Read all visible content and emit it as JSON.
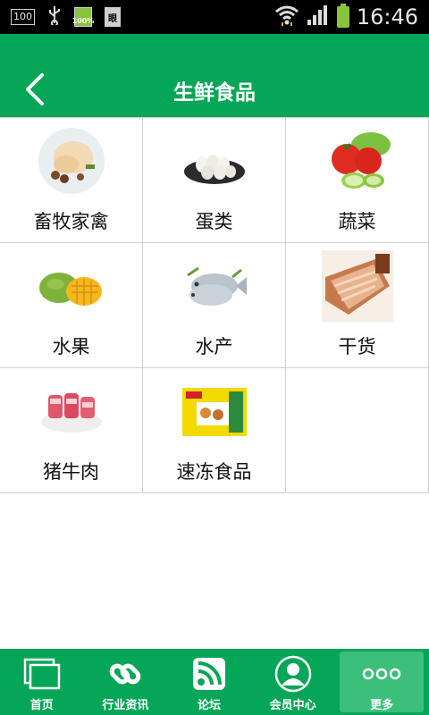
{
  "status_bar": {
    "sim_label": "100",
    "battery_small_label": "100%",
    "doc_label": "眼",
    "time": "16:46"
  },
  "header": {
    "title": "生鲜食品",
    "back_icon": "chevron-left-icon"
  },
  "categories": [
    {
      "label": "畜牧家禽",
      "icon": "poultry-image"
    },
    {
      "label": "蛋类",
      "icon": "eggs-image"
    },
    {
      "label": "蔬菜",
      "icon": "vegetables-image"
    },
    {
      "label": "水果",
      "icon": "mango-image"
    },
    {
      "label": "水产",
      "icon": "fish-image"
    },
    {
      "label": "干货",
      "icon": "dried-meat-image"
    },
    {
      "label": "猪牛肉",
      "icon": "pork-ribs-image"
    },
    {
      "label": "速冻食品",
      "icon": "frozen-food-image"
    }
  ],
  "bottom_nav": [
    {
      "label": "首页",
      "icon": "home-icon"
    },
    {
      "label": "行业资讯",
      "icon": "link-icon"
    },
    {
      "label": "论坛",
      "icon": "rss-icon"
    },
    {
      "label": "会员中心",
      "icon": "user-icon"
    },
    {
      "label": "更多",
      "icon": "more-icon",
      "active": true
    }
  ],
  "colors": {
    "brand_green": "#05a657",
    "active_tab": "#3bbf7a"
  }
}
